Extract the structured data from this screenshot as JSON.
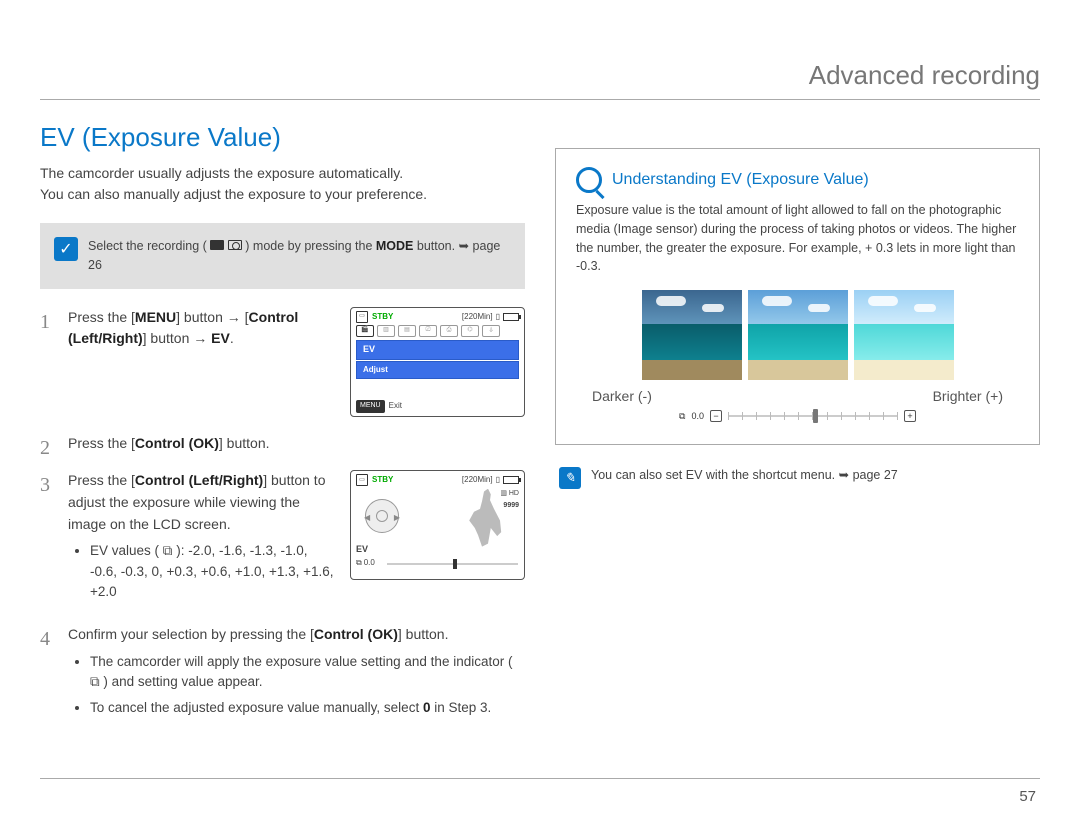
{
  "chapter": "Advanced recording",
  "section": "EV (Exposure Value)",
  "intro_l1": "The camcorder usually adjusts the exposure automatically.",
  "intro_l2": "You can also manually adjust the exposure to your preference.",
  "prereq": {
    "pre": "Select the recording (",
    "post": ") mode by pressing the ",
    "mode_label": "MODE",
    "tail": " button. ",
    "page_ref": "page 26"
  },
  "steps": {
    "s1": {
      "a": "Press the [",
      "menu": "MENU",
      "b": "] button → [",
      "ctrl_lr": "Control (Left/Right)",
      "c": "] button → ",
      "ev": "EV",
      "d": "."
    },
    "s2": {
      "a": "Press the [",
      "ctrl_ok": "Control (OK)",
      "b": "] button."
    },
    "s3": {
      "a": "Press the [",
      "ctrl_lr": "Control (Left/Right)",
      "b": "] button to adjust the exposure while viewing the image on the LCD screen.",
      "bullet_a": "EV values (",
      "bullet_b": "): -2.0, -1.6, -1.3, -1.0, -0.6, -0.3, 0, +0.3, +0.6, +1.0, +1.3, +1.6, +2.0"
    },
    "s4": {
      "a": "Confirm your selection by pressing the [",
      "ctrl_ok": "Control (OK)",
      "b": "] button.",
      "bullet1a": "The camcorder will apply the exposure value setting and the indicator (",
      "bullet1b": ") and setting value appear.",
      "bullet2a": "To cancel the adjusted exposure value manually, select ",
      "bullet2_zero": "0",
      "bullet2b": " in Step 3."
    }
  },
  "lcd1": {
    "stby": "STBY",
    "time": "[220Min]",
    "menu_ev": "EV",
    "menu_adjust": "Adjust",
    "exit": "Exit",
    "menu_tag": "MENU"
  },
  "lcd2": {
    "stby": "STBY",
    "time": "[220Min]",
    "count": "9999",
    "hd": "HD",
    "ev_label": "EV",
    "ev_value": "0.0"
  },
  "info": {
    "title": "Understanding EV (Exposure Value)",
    "body": "Exposure value is the total amount of light allowed to fall on the photographic media (Image sensor) during the process of taking photos or videos. The higher the number, the greater the exposure. For example, + 0.3 lets in more light than -0.3.",
    "darker": "Darker (-)",
    "brighter": "Brighter (+)",
    "slider_val": "0.0"
  },
  "shortcut": {
    "text": "You can also set EV with the shortcut menu. ",
    "page_ref": "page 27"
  },
  "page_number": "57"
}
